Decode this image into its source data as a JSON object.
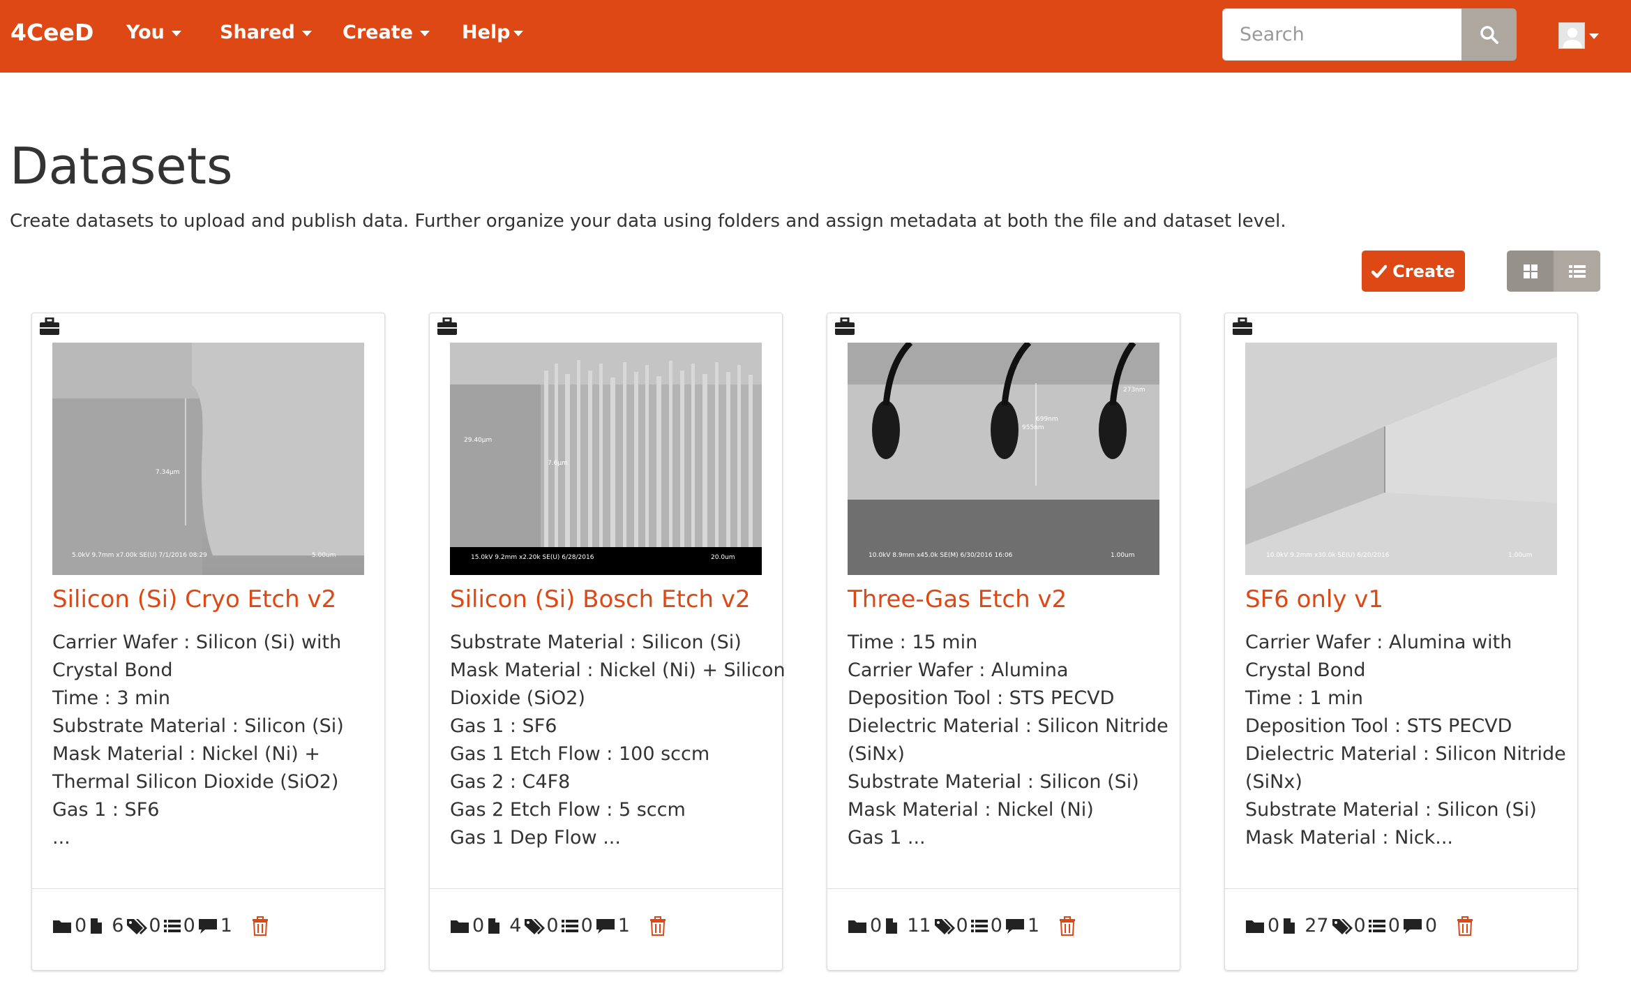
{
  "nav": {
    "brand": "4CeeD",
    "items": [
      {
        "label": "You"
      },
      {
        "label": "Shared"
      },
      {
        "label": "Create"
      },
      {
        "label": "Help"
      }
    ],
    "search_placeholder": "Search"
  },
  "page": {
    "title": "Datasets",
    "description": "Create datasets to upload and publish data. Further organize your data using folders and assign metadata at both the file and dataset level.",
    "create_label": "Create"
  },
  "cards": [
    {
      "title": "Silicon (Si) Cryo Etch v2",
      "lines": [
        "Carrier Wafer : Silicon (Si) with",
        "Crystal Bond",
        "Time : 3 min",
        "Substrate Material : Silicon (Si)",
        "Mask Material : Nickel (Ni) +",
        "Thermal Silicon Dioxide (SiO2)",
        "Gas 1 : SF6",
        "..."
      ],
      "thumb_caption": "5.0kV 9.7mm x7.00k SE(U) 7/1/2016 08:29",
      "thumb_scale": "5.00um",
      "thumb_measure": "7.34µm",
      "stats": {
        "folders": "0",
        "files": "6",
        "tags": "0",
        "metadata": "0",
        "comments": "1"
      }
    },
    {
      "title": "Silicon (Si) Bosch Etch v2",
      "lines": [
        "Substrate Material : Silicon (Si)",
        "Mask Material : Nickel (Ni) + Silicon",
        "Dioxide (SiO2)",
        "Gas 1 : SF6",
        "Gas 1 Etch Flow : 100 sccm",
        "Gas 2 : C4F8",
        "Gas 2 Etch Flow : 5 sccm",
        "Gas 1 Dep Flow ..."
      ],
      "thumb_caption": "15.0kV 9.2mm x2.20k SE(U) 6/28/2016",
      "thumb_scale": "20.0um",
      "thumb_measure": "29.40µm",
      "thumb_measure2": "7.6µm",
      "stats": {
        "folders": "0",
        "files": "4",
        "tags": "0",
        "metadata": "0",
        "comments": "1"
      }
    },
    {
      "title": "Three-Gas Etch v2",
      "lines": [
        "Time : 15 min",
        "Carrier Wafer : Alumina",
        "Deposition Tool : STS PECVD",
        "Dielectric Material : Silicon Nitride",
        "(SiNx)",
        "Substrate Material : Silicon (Si)",
        "Mask Material : Nickel (Ni)",
        "Gas 1 ..."
      ],
      "thumb_caption": "10.0kV 8.9mm x45.0k SE(M) 6/30/2016 16:06",
      "thumb_scale": "1.00um",
      "thumb_measure": "699nm",
      "thumb_measure2": "955nm",
      "thumb_measure3": "273nm",
      "stats": {
        "folders": "0",
        "files": "11",
        "tags": "0",
        "metadata": "0",
        "comments": "1"
      }
    },
    {
      "title": "SF6 only v1",
      "lines": [
        "Carrier Wafer : Alumina with",
        "Crystal Bond",
        "Time : 1 min",
        "Deposition Tool : STS PECVD",
        "Dielectric Material : Silicon Nitride",
        "(SiNx)",
        "Substrate Material : Silicon (Si)",
        "Mask Material : Nick..."
      ],
      "thumb_caption": "10.0kV 9.2mm x30.0k SE(U) 6/20/2016",
      "thumb_scale": "1.00um",
      "stats": {
        "folders": "0",
        "files": "27",
        "tags": "0",
        "metadata": "0",
        "comments": "0"
      }
    }
  ],
  "colors": {
    "brand": "#dd4814",
    "button_gray": "#aea79f",
    "text": "#333333"
  },
  "icons": {
    "card_header": "briefcase-icon",
    "stats": [
      "folder-icon",
      "file-icon",
      "tags-icon",
      "list-icon",
      "comment-icon",
      "trash-icon"
    ]
  }
}
